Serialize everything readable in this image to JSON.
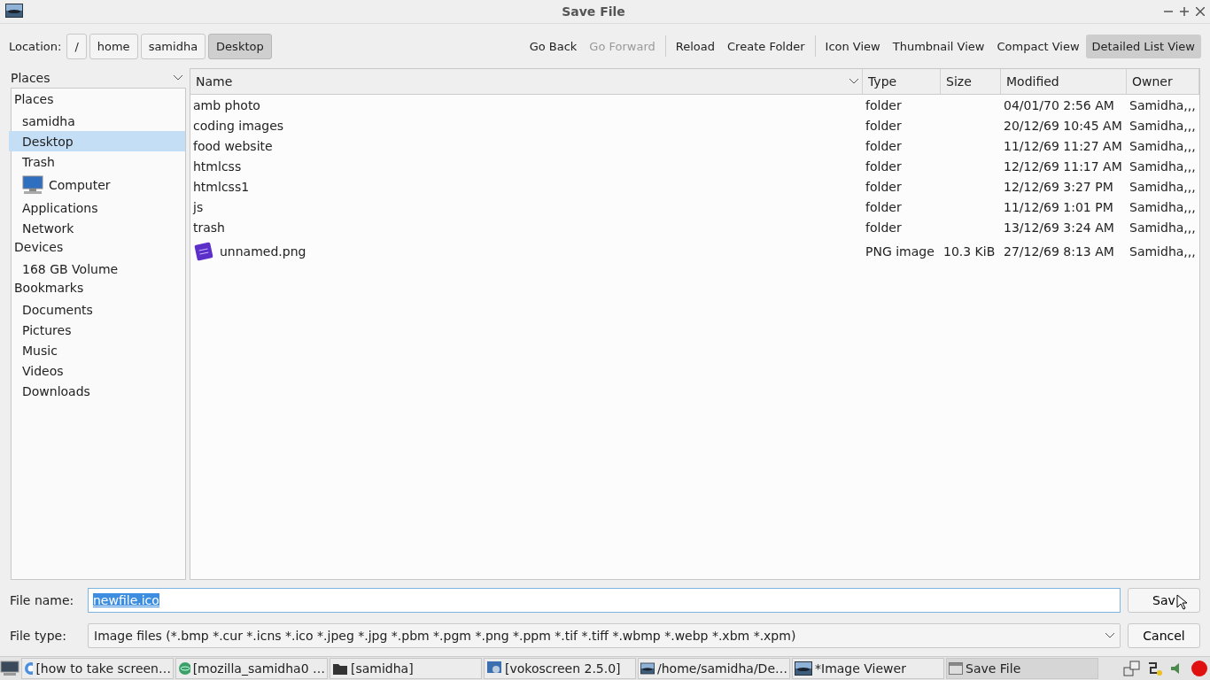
{
  "window": {
    "title": "Save File"
  },
  "location": {
    "label": "Location:",
    "crumbs": [
      {
        "label": "/",
        "selected": false
      },
      {
        "label": "home",
        "selected": false
      },
      {
        "label": "samidha",
        "selected": false
      },
      {
        "label": "Desktop",
        "selected": true
      }
    ]
  },
  "toolbar": [
    {
      "label": "Go Back",
      "disabled": false,
      "selected": false,
      "separator_before": false
    },
    {
      "label": "Go Forward",
      "disabled": true,
      "selected": false,
      "separator_before": false
    },
    {
      "label": "Reload",
      "disabled": false,
      "selected": false,
      "separator_before": true
    },
    {
      "label": "Create Folder",
      "disabled": false,
      "selected": false,
      "separator_before": false
    },
    {
      "label": "Icon View",
      "disabled": false,
      "selected": false,
      "separator_before": true
    },
    {
      "label": "Thumbnail View",
      "disabled": false,
      "selected": false,
      "separator_before": false
    },
    {
      "label": "Compact View",
      "disabled": false,
      "selected": false,
      "separator_before": false
    },
    {
      "label": "Detailed List View",
      "disabled": false,
      "selected": true,
      "separator_before": false
    }
  ],
  "sidebar": {
    "dropdown": "Places",
    "sections": [
      {
        "heading": "Places",
        "items": [
          {
            "label": "samidha",
            "kind": "place",
            "selected": false
          },
          {
            "label": "Desktop",
            "kind": "place",
            "selected": true
          },
          {
            "label": "Trash",
            "kind": "place",
            "selected": false
          },
          {
            "label": "Computer",
            "kind": "computer",
            "selected": false
          },
          {
            "label": "Applications",
            "kind": "place",
            "selected": false
          },
          {
            "label": "Network",
            "kind": "place",
            "selected": false
          }
        ]
      },
      {
        "heading": "Devices",
        "items": [
          {
            "label": "168 GB Volume",
            "kind": "place",
            "selected": false
          }
        ]
      },
      {
        "heading": "Bookmarks",
        "items": [
          {
            "label": "Documents",
            "kind": "place",
            "selected": false
          },
          {
            "label": "Pictures",
            "kind": "place",
            "selected": false
          },
          {
            "label": "Music",
            "kind": "place",
            "selected": false
          },
          {
            "label": "Videos",
            "kind": "place",
            "selected": false
          },
          {
            "label": "Downloads",
            "kind": "place",
            "selected": false
          }
        ]
      }
    ]
  },
  "table": {
    "columns": [
      "Name",
      "Type",
      "Size",
      "Modified",
      "Owner"
    ],
    "rows": [
      {
        "kind": "folder",
        "name": "amb photo",
        "type": "folder",
        "modified": "04/01/70 2:56 AM",
        "owner": "Samidha,,,"
      },
      {
        "kind": "folder",
        "name": "coding images",
        "type": "folder",
        "modified": "20/12/69 10:45 AM",
        "owner": "Samidha,,,"
      },
      {
        "kind": "folder",
        "name": "food website",
        "type": "folder",
        "modified": "11/12/69 11:27 AM",
        "owner": "Samidha,,,"
      },
      {
        "kind": "folder",
        "name": "htmlcss",
        "type": "folder",
        "modified": "12/12/69 11:17 AM",
        "owner": "Samidha,,,"
      },
      {
        "kind": "folder",
        "name": "htmlcss1",
        "type": "folder",
        "modified": "12/12/69 3:27 PM",
        "owner": "Samidha,,,"
      },
      {
        "kind": "folder",
        "name": "js",
        "type": "folder",
        "modified": "11/12/69 1:01 PM",
        "owner": "Samidha,,,"
      },
      {
        "kind": "folder",
        "name": "trash",
        "type": "folder",
        "modified": "13/12/69 3:24 AM",
        "owner": "Samidha,,,"
      },
      {
        "kind": "image",
        "name": "unnamed.png",
        "type": "PNG image",
        "size": "10.3 KiB",
        "modified": "27/12/69 8:13 AM",
        "owner": "Samidha,,,"
      }
    ]
  },
  "file_name": {
    "label": "File name:",
    "value": "newfile.ico"
  },
  "file_type": {
    "label": "File type:",
    "value": "Image files (*.bmp *.cur *.icns *.ico *.jpeg *.jpg *.pbm *.pgm *.png *.ppm *.tif *.tiff *.wbmp *.webp *.xbm *.xpm)"
  },
  "buttons": [
    "Sav",
    "Cancel"
  ],
  "taskbar": {
    "items": [
      {
        "label": "[how to take screen…",
        "kind": "browser",
        "selected": false
      },
      {
        "label": "[mozilla_samidha0 …",
        "kind": "atom",
        "selected": false
      },
      {
        "label": "[samidha]",
        "kind": "folder",
        "selected": false
      },
      {
        "label": "[vokoscreen 2.5.0]",
        "kind": "app",
        "selected": false
      },
      {
        "label": "/home/samidha/De…",
        "kind": "image",
        "selected": false
      },
      {
        "label": "*Image Viewer",
        "kind": "image",
        "selected": false
      },
      {
        "label": "Save File",
        "kind": "window",
        "selected": true
      }
    ]
  }
}
